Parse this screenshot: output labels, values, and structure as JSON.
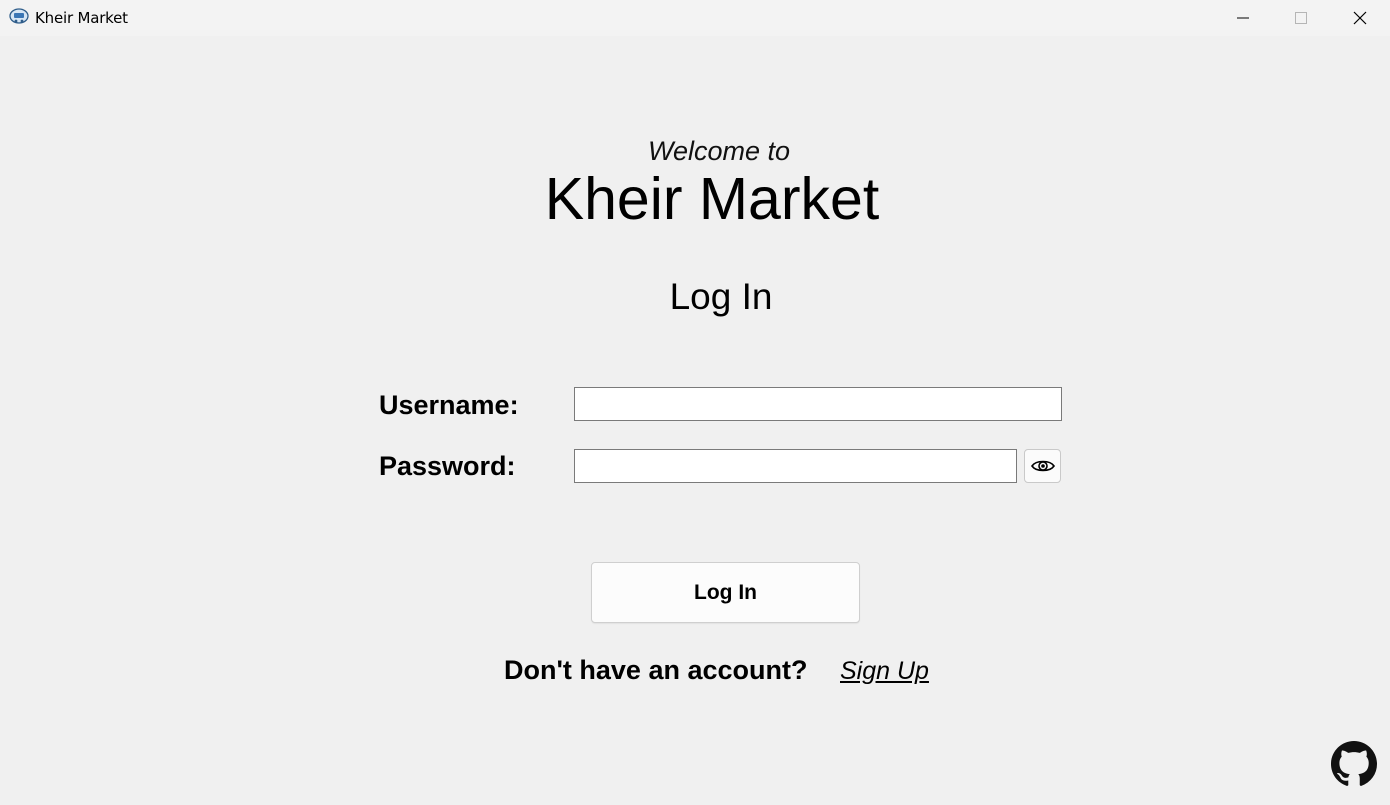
{
  "window": {
    "title": "Kheir Market",
    "icon": "app-cart-icon",
    "controls": [
      "minimize-icon",
      "maximize-icon",
      "close-icon"
    ]
  },
  "header": {
    "welcome": "Welcome to",
    "brand": "Kheir Market"
  },
  "form": {
    "heading": "Log In",
    "username_label": "Username:",
    "username_value": "",
    "password_label": "Password:",
    "password_value": "",
    "show_password_icon": "eye-icon",
    "submit_label": "Log In"
  },
  "footer": {
    "no_account_text": "Don't have an account?",
    "signup_label": "Sign Up",
    "github_icon": "github-icon"
  },
  "colors": {
    "background": "#f0f0f0",
    "titlebar": "#f3f3f3",
    "input_border": "#7a7a7a",
    "text": "#000000"
  }
}
